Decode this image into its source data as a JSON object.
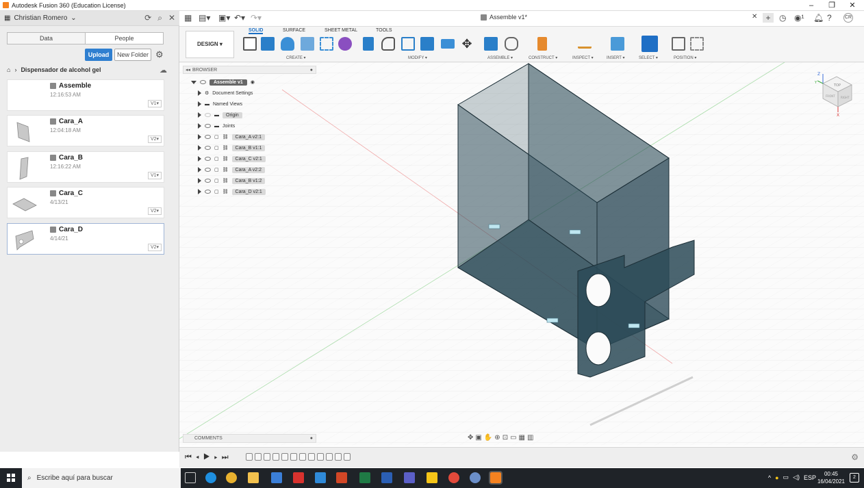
{
  "window": {
    "title": "Autodesk Fusion 360 (Education License)",
    "min": "–",
    "max": "❐",
    "close": "✕"
  },
  "data_panel": {
    "user": "Christian Romero",
    "tabs": [
      "Data",
      "People"
    ],
    "upload_label": "Upload",
    "new_folder_label": "New Folder",
    "breadcrumb": "Dispensador de alcohol gel",
    "files": [
      {
        "name": "Assemble",
        "date": "12:16:53 AM",
        "version": "V1▾"
      },
      {
        "name": "Cara_A",
        "date": "12:04:18 AM",
        "version": "V2▾"
      },
      {
        "name": "Cara_B",
        "date": "12:16:22 AM",
        "version": "V1▾"
      },
      {
        "name": "Cara_C",
        "date": "4/13/21",
        "version": "V2▾"
      },
      {
        "name": "Cara_D",
        "date": "4/14/21",
        "version": "V2▾"
      }
    ]
  },
  "document_tab": "Assemble v1*",
  "toolbar": {
    "workspace": "DESIGN ▾",
    "tabs": [
      "SOLID",
      "SURFACE",
      "SHEET METAL",
      "TOOLS"
    ],
    "groups": [
      "CREATE ▾",
      "MODIFY ▾",
      "ASSEMBLE ▾",
      "CONSTRUCT ▾",
      "INSPECT ▾",
      "INSERT ▾",
      "SELECT ▾",
      "POSITION ▾"
    ]
  },
  "browser": {
    "header": "BROWSER",
    "root": "Assemble v1",
    "items": [
      "Document Settings",
      "Named Views",
      "Origin",
      "Joints",
      "Cara_A v2:1",
      "Cara_B v1:1",
      "Cara_C v2:1",
      "Cara_A v2:2",
      "Cara_B v1:2",
      "Cara_D v2:1"
    ]
  },
  "comments_label": "COMMENTS",
  "viewcube": {
    "top": "TOP",
    "front": "FRONT",
    "right": "RIGHT",
    "axis_z": "Z",
    "axis_y": "Y",
    "axis_x": "X"
  },
  "taskbar": {
    "search_placeholder": "Escribe aquí para buscar",
    "lang": "ESP",
    "time": "00:45",
    "date": "16/04/2021",
    "notifications": "2"
  },
  "colors": {
    "accent": "#1a6fc4",
    "upload": "#2f7fd0",
    "model": "#2b4a57"
  }
}
